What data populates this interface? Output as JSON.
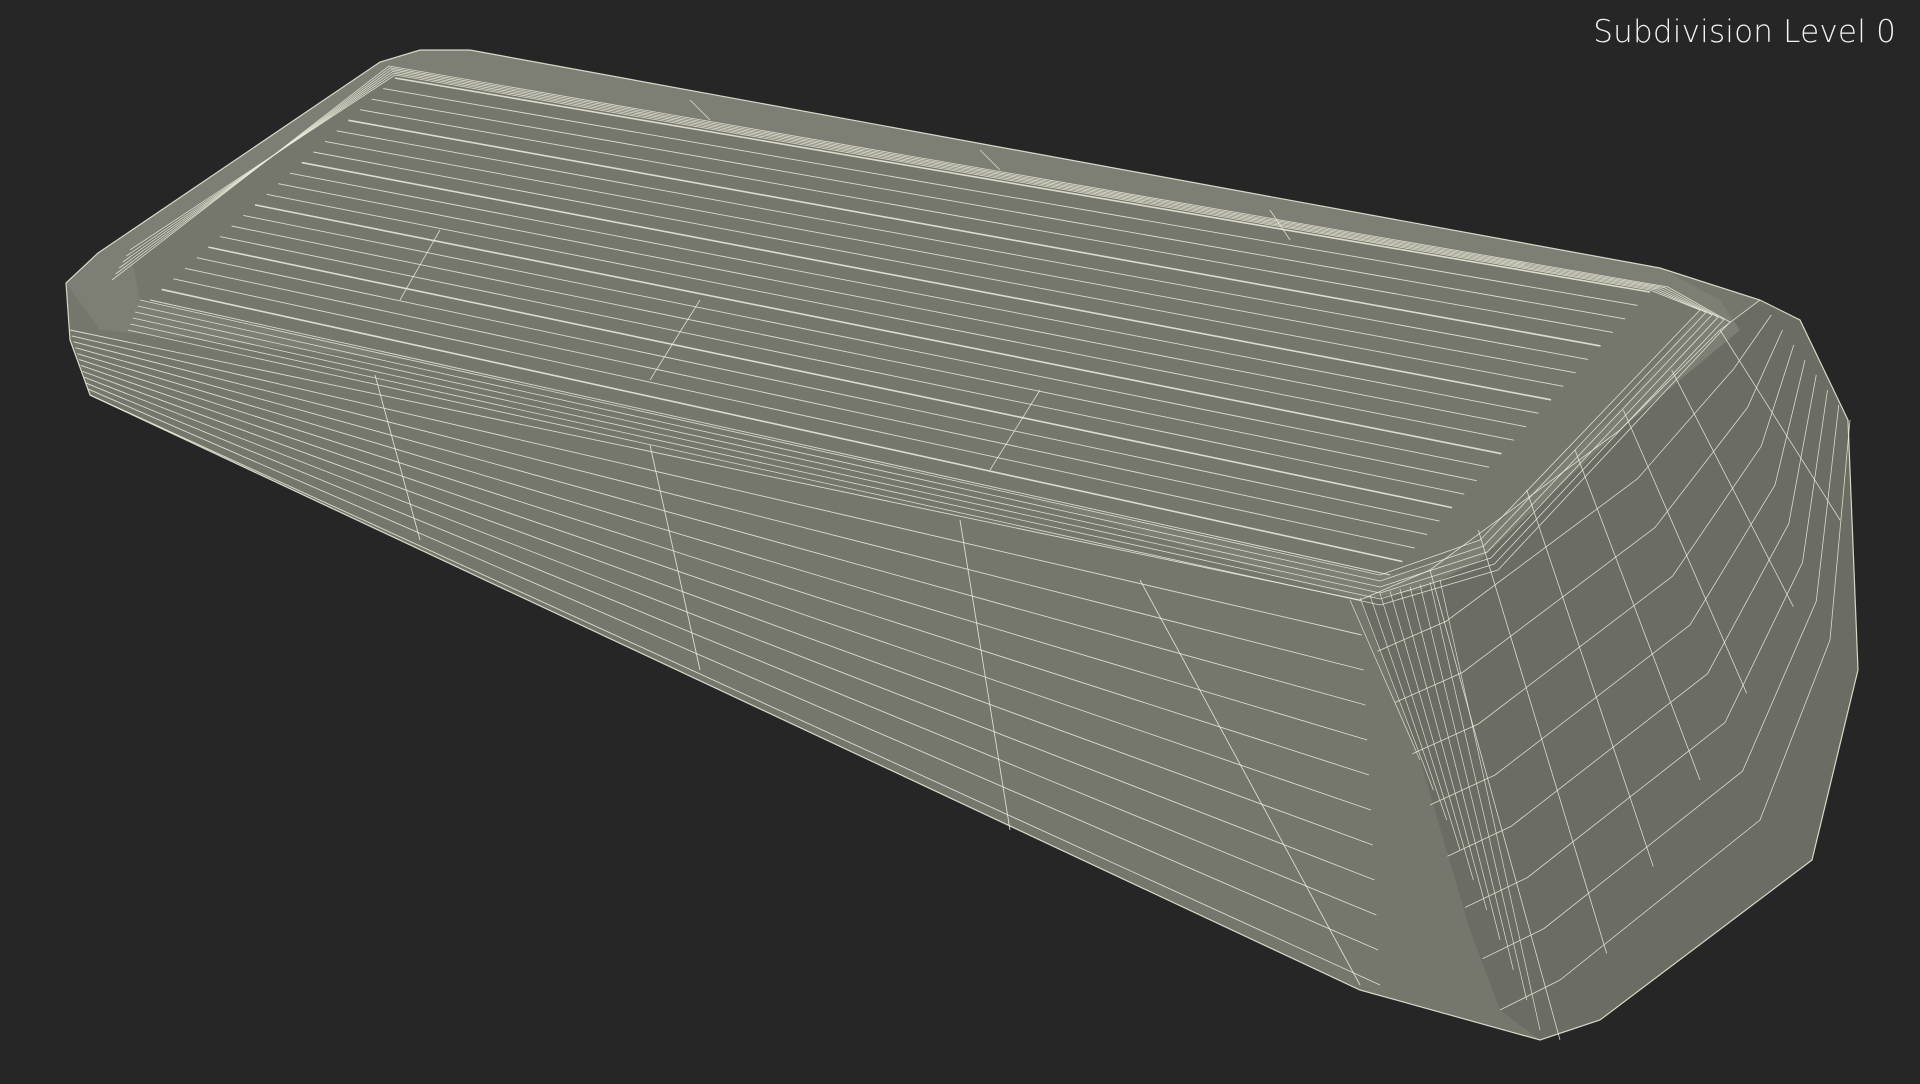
{
  "viewport": {
    "overlay_label": "Subdivision Level 0",
    "background_color": "#262626",
    "model_fill_color": "#75766c",
    "model_top_fill_color": "#7d7e74",
    "model_side_dark_color": "#6b6c63",
    "wireframe_color": "#eeeedd"
  }
}
